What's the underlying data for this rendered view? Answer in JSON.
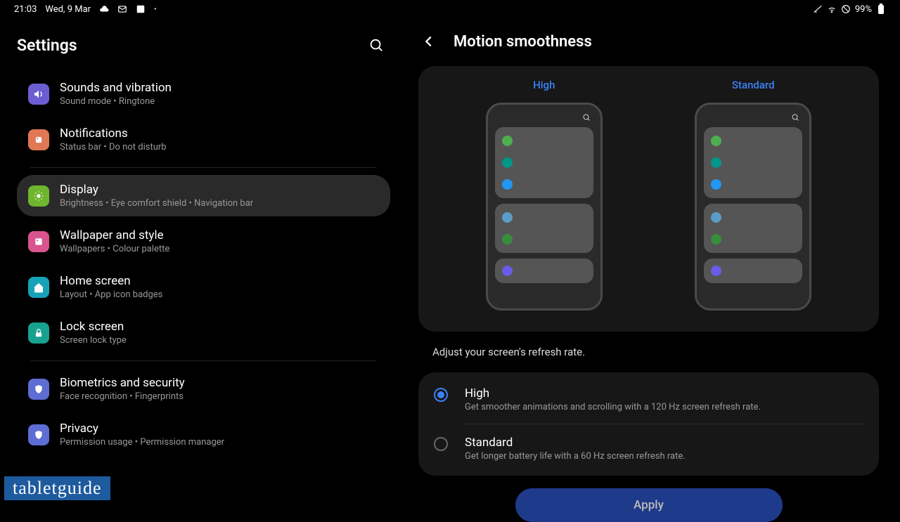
{
  "status": {
    "time": "21:03",
    "date": "Wed, 9 Mar",
    "battery": "99%"
  },
  "settings": {
    "title": "Settings",
    "items": [
      {
        "title": "Sounds and vibration",
        "sub": "Sound mode  •  Ringtone",
        "icon": "#6d5dd3",
        "glyph": "volume"
      },
      {
        "title": "Notifications",
        "sub": "Status bar  •  Do not disturb",
        "icon": "#e07856",
        "glyph": "bell"
      },
      {
        "title": "Display",
        "sub": "Brightness  •  Eye comfort shield  •  Navigation bar",
        "icon": "#6fb52f",
        "glyph": "sun",
        "selected": true
      },
      {
        "title": "Wallpaper and style",
        "sub": "Wallpapers  •  Colour palette",
        "icon": "#d9548f",
        "glyph": "pic"
      },
      {
        "title": "Home screen",
        "sub": "Layout  •  App icon badges",
        "icon": "#17a2b8",
        "glyph": "home"
      },
      {
        "title": "Lock screen",
        "sub": "Screen lock type",
        "icon": "#17a28f",
        "glyph": "lock"
      },
      {
        "title": "Biometrics and security",
        "sub": "Face recognition  •  Fingerprints",
        "icon": "#5d6dd3",
        "glyph": "shield"
      },
      {
        "title": "Privacy",
        "sub": "Permission usage  •  Permission manager",
        "icon": "#5d6dd3",
        "glyph": "shield"
      }
    ]
  },
  "detail": {
    "title": "Motion smoothness",
    "preview": {
      "high": "High",
      "standard": "Standard"
    },
    "description": "Adjust your screen's refresh rate.",
    "options": [
      {
        "title": "High",
        "sub": "Get smoother animations and scrolling with a 120 Hz screen refresh rate.",
        "checked": true
      },
      {
        "title": "Standard",
        "sub": "Get longer battery life with a 60 Hz screen refresh rate.",
        "checked": false
      }
    ],
    "apply": "Apply"
  },
  "watermark": "tabletguide"
}
